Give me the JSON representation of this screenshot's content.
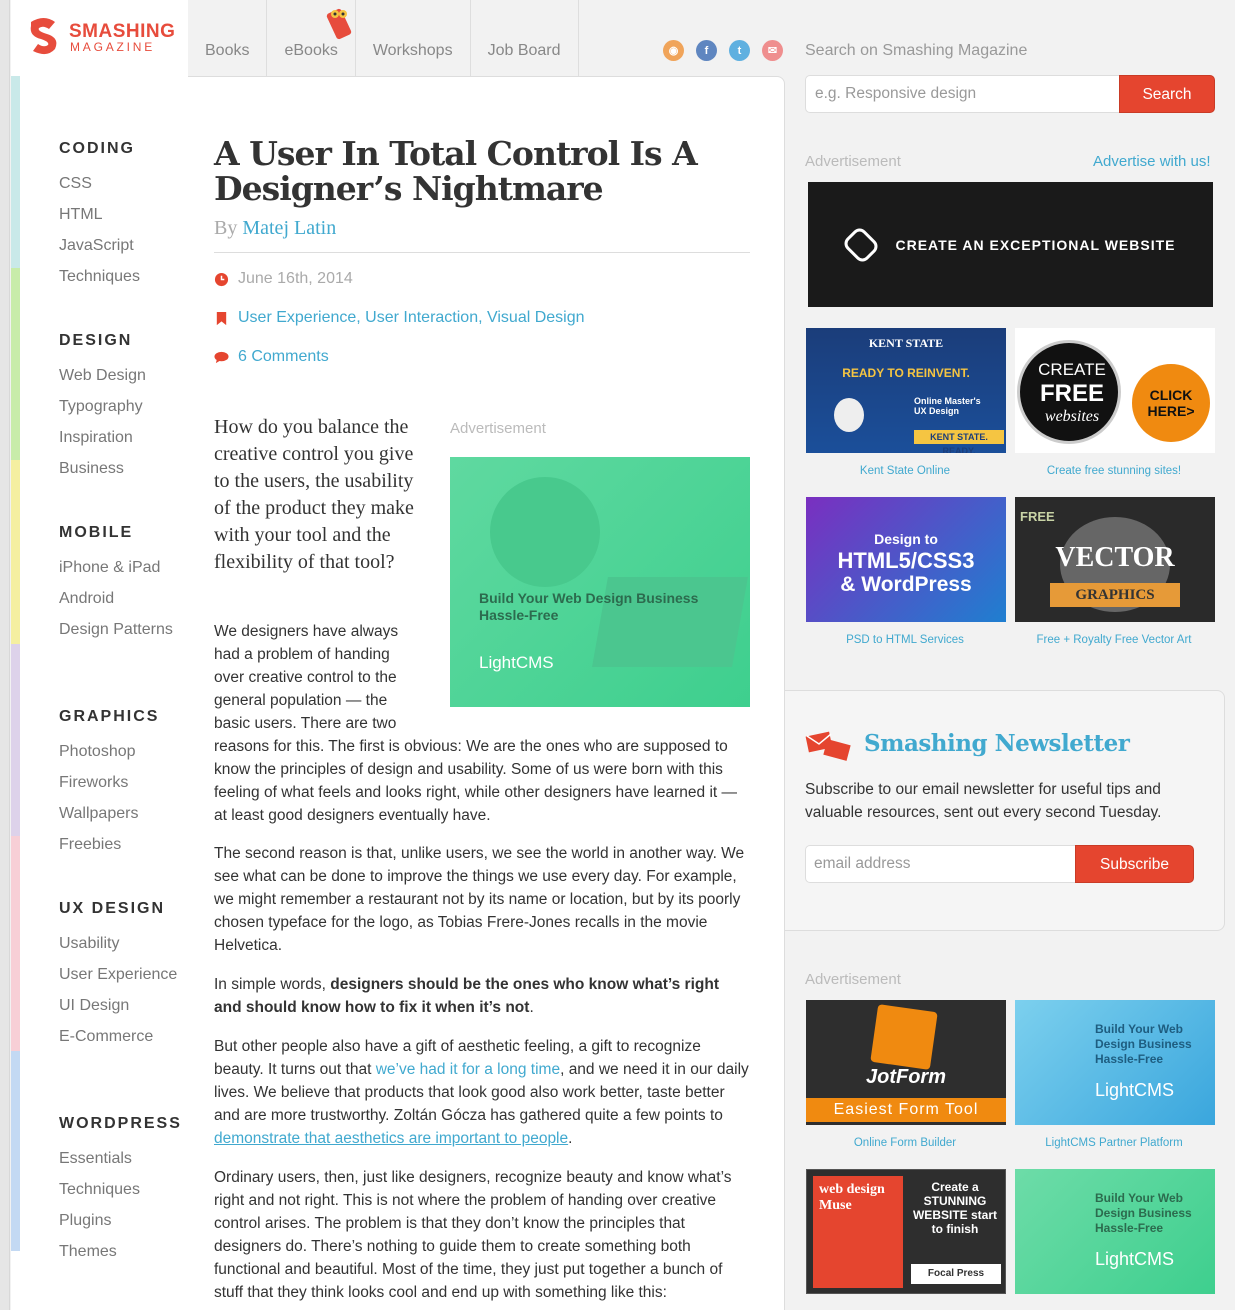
{
  "logo": {
    "word1": "SMASHING",
    "word2": "MAGAZINE"
  },
  "nav": [
    "Books",
    "eBooks",
    "Workshops",
    "Job Board"
  ],
  "social": [
    {
      "icon": "rss-icon",
      "color": "#f0a45a",
      "glyph": "◉"
    },
    {
      "icon": "facebook-icon",
      "color": "#5f86c0",
      "glyph": "f"
    },
    {
      "icon": "twitter-icon",
      "color": "#5fb0e0",
      "glyph": "t"
    },
    {
      "icon": "email-icon",
      "color": "#ef8e8e",
      "glyph": "✉"
    }
  ],
  "search": {
    "label": "Search on Smashing Magazine",
    "placeholder": "e.g. Responsive design",
    "button": "Search"
  },
  "sidebar": [
    {
      "title": "CODING",
      "color": "#c9e9e9",
      "items": [
        "CSS",
        "HTML",
        "JavaScript",
        "Techniques"
      ]
    },
    {
      "title": "DESIGN",
      "color": "#c8ecaa",
      "items": [
        "Web Design",
        "Typography",
        "Inspiration",
        "Business"
      ]
    },
    {
      "title": "MOBILE",
      "color": "#f5efa1",
      "items": [
        "iPhone & iPad",
        "Android",
        "Design Patterns"
      ]
    },
    {
      "title": "GRAPHICS",
      "color": "#ddd2ea",
      "items": [
        "Photoshop",
        "Fireworks",
        "Wallpapers",
        "Freebies"
      ]
    },
    {
      "title": "UX DESIGN",
      "color": "#f7cfd6",
      "items": [
        "Usability",
        "User Experience",
        "UI Design",
        "E-Commerce"
      ]
    },
    {
      "title": "WORDPRESS",
      "color": "#c3d9f3",
      "items": [
        "Essentials",
        "Techniques",
        "Plugins",
        "Themes"
      ]
    }
  ],
  "article": {
    "title": "A User In Total Control Is A Designer’s Nightmare",
    "by": "By",
    "author": "Matej Latin",
    "date": "June 16th, 2014",
    "categories": "User Experience, User Interaction, Visual Design",
    "comments": "6 Comments",
    "lead": "How do you balance the creative control you give to the users, the usability of the product they make with your tool and the flexibility of that tool?",
    "p1a": "We designers have always had a problem of handing over creative control to the general population — the basic users. There are two",
    "p1b": "reasons for this. The first is obvious: We are the ones who are supposed to know the principles of design and usability. Some of us were born with this feeling of what feels and looks right, while other designers have learned it — at least good designers eventually have.",
    "p2": "The second reason is that, unlike users, we see the world in another way. We see what can be done to improve the things we use every day. For example, we might remember a restaurant not by its name or location, but by its poorly chosen typeface for the logo, as Tobias Frere-Jones recalls in the movie Helvetica.",
    "p3_pre": "In simple words, ",
    "p3_bold": "designers should be the ones who know what’s right and should know how to fix it when it’s not",
    "p3_post": ".",
    "p4_a": "But other people also have a gift of aesthetic feeling, a gift to recognize beauty. It turns out that ",
    "p4_link1": "we’ve had it for a long time",
    "p4_b": ", and we need it in our daily lives. We believe that products that look good also work better, taste better and are more trustworthy. Zoltán Gócza has gathered quite a few points to ",
    "p4_link2": "demonstrate that aesthetics are important to people",
    "p4_c": ".",
    "p5": "Ordinary users, then, just like designers, recognize beauty and know what’s right and not right. This is not where the problem of handing over creative control arises. The problem is that they don’t know the principles that designers do. There’s nothing to guide them to create something both functional and beautiful. Most of the time, they just put together a bunch of stuff that they think looks cool and end up with something like this:"
  },
  "main_ad": {
    "label": "Advertisement",
    "headline": "Build Your Web Design Business Hassle-Free",
    "brand": "LightCMS"
  },
  "right": {
    "ad_label": "Advertisement",
    "advertise": "Advertise with us!",
    "banner": "CREATE AN EXCEPTIONAL WEBSITE",
    "tiles1": [
      {
        "caption": "Kent State Online",
        "l1": "KENT STATE",
        "l2": "READY TO REINVENT.",
        "l3": "Online Master's UX Design",
        "l4": "KENT STATE. READY."
      },
      {
        "caption": "Create free stunning sites!",
        "l1": "CREATE",
        "l2": "FREE",
        "l3": "websites",
        "l4": "CLICK HERE>"
      },
      {
        "caption": "PSD to HTML Services",
        "l1": "Design to",
        "l2": "HTML5/CSS3",
        "l3": "& WordPress"
      },
      {
        "caption": "Free + Royalty Free Vector Art",
        "l1": "FREE",
        "l2": "VECTOR",
        "l3": "GRAPHICS"
      }
    ],
    "newsletter": {
      "title": "Smashing Newsletter",
      "text": "Subscribe to our email newsletter for useful tips and valuable resources, sent out every second Tuesday.",
      "placeholder": "email address",
      "button": "Subscribe"
    },
    "ad_label2": "Advertisement",
    "tiles2": [
      {
        "caption": "Online Form Builder",
        "l1": "JotForm",
        "l2": "Easiest Form Tool"
      },
      {
        "caption": "LightCMS Partner Platform",
        "l1": "Build Your Web Design Business Hassle-Free",
        "l2": "LightCMS"
      },
      {
        "caption": "",
        "l1": "web design Muse",
        "l2": "Create a STUNNING WEBSITE start to finish",
        "l3": "Focal Press"
      },
      {
        "caption": "",
        "l1": "Build Your Web Design Business Hassle-Free",
        "l2": "LightCMS"
      }
    ]
  }
}
